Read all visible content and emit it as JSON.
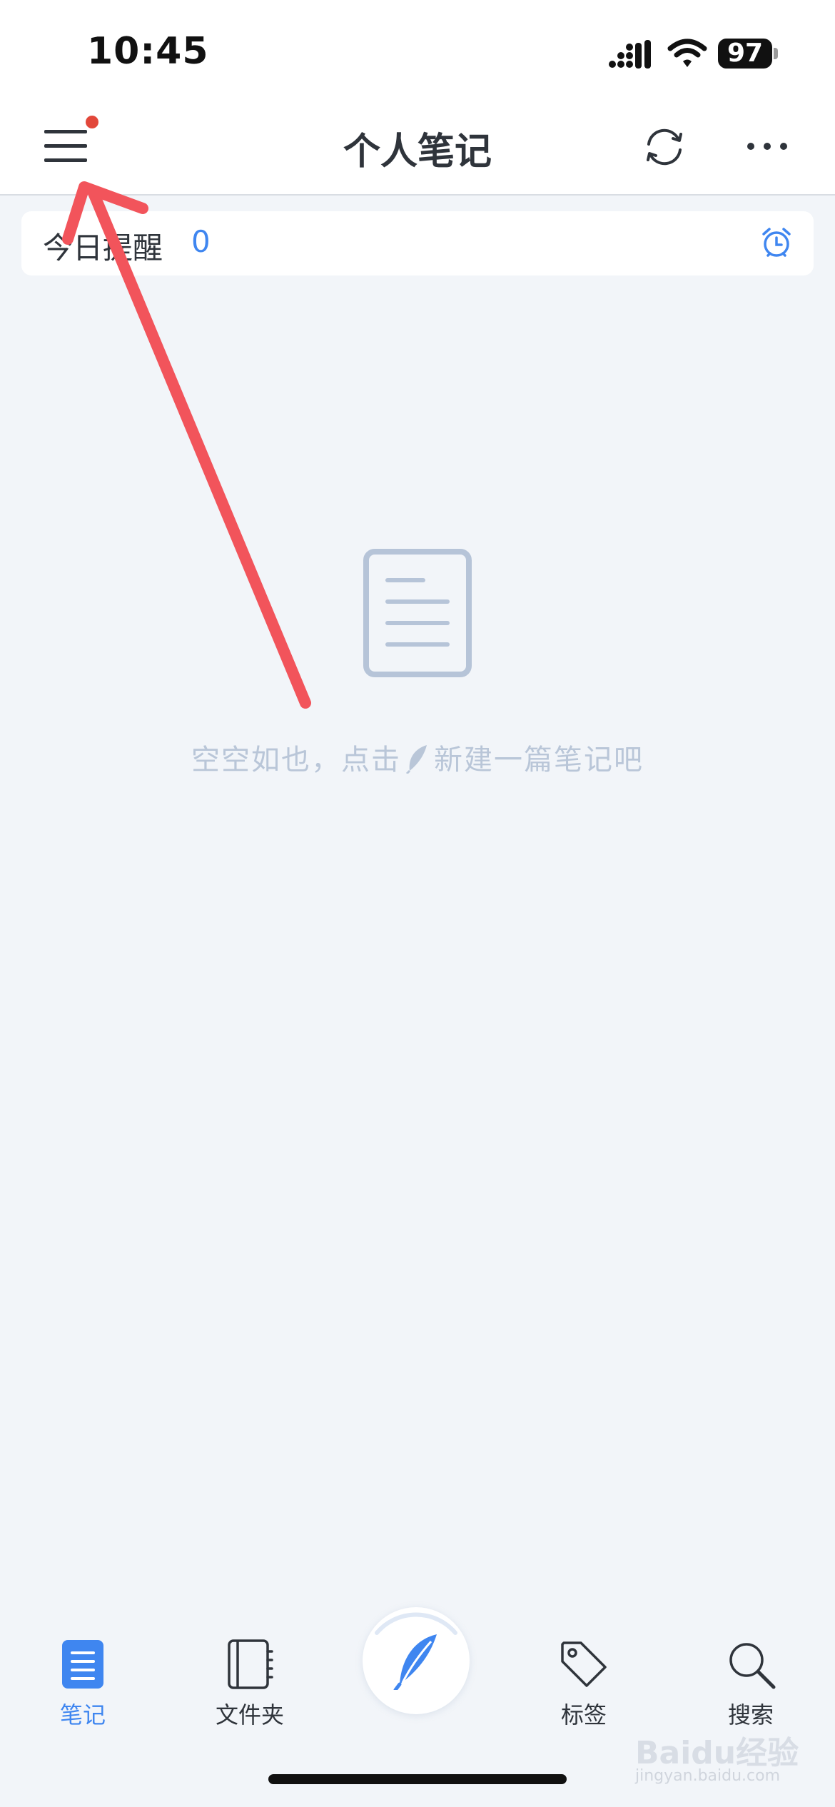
{
  "status_bar": {
    "time": "10:45",
    "battery": "97",
    "icons": [
      "signal-icon",
      "wifi-icon",
      "battery-icon"
    ]
  },
  "header": {
    "title": "个人笔记",
    "icons": [
      "menu-icon",
      "sync-icon",
      "more-icon"
    ],
    "notification_color": "#e2473a"
  },
  "reminder": {
    "label": "今日提醒",
    "count": "0",
    "icon": "alarm-clock-icon"
  },
  "empty_state": {
    "icon": "document-icon",
    "text_before": "空空如也，点击",
    "text_after": "新建一篇笔记吧"
  },
  "tabs": [
    {
      "label": "笔记",
      "icon": "notes-icon",
      "active": true
    },
    {
      "label": "文件夹",
      "icon": "notebook-icon",
      "active": false
    },
    {
      "label": "标签",
      "icon": "tag-icon",
      "active": false
    },
    {
      "label": "搜索",
      "icon": "search-icon",
      "active": false
    }
  ],
  "compose": {
    "icon": "feather-icon"
  },
  "watermark": {
    "brand": "Baidu经验",
    "url": "jingyan.baidu.com"
  },
  "colors": {
    "accent": "#3f86f0",
    "background": "#f2f5f9",
    "annotation": "#f2545b"
  }
}
